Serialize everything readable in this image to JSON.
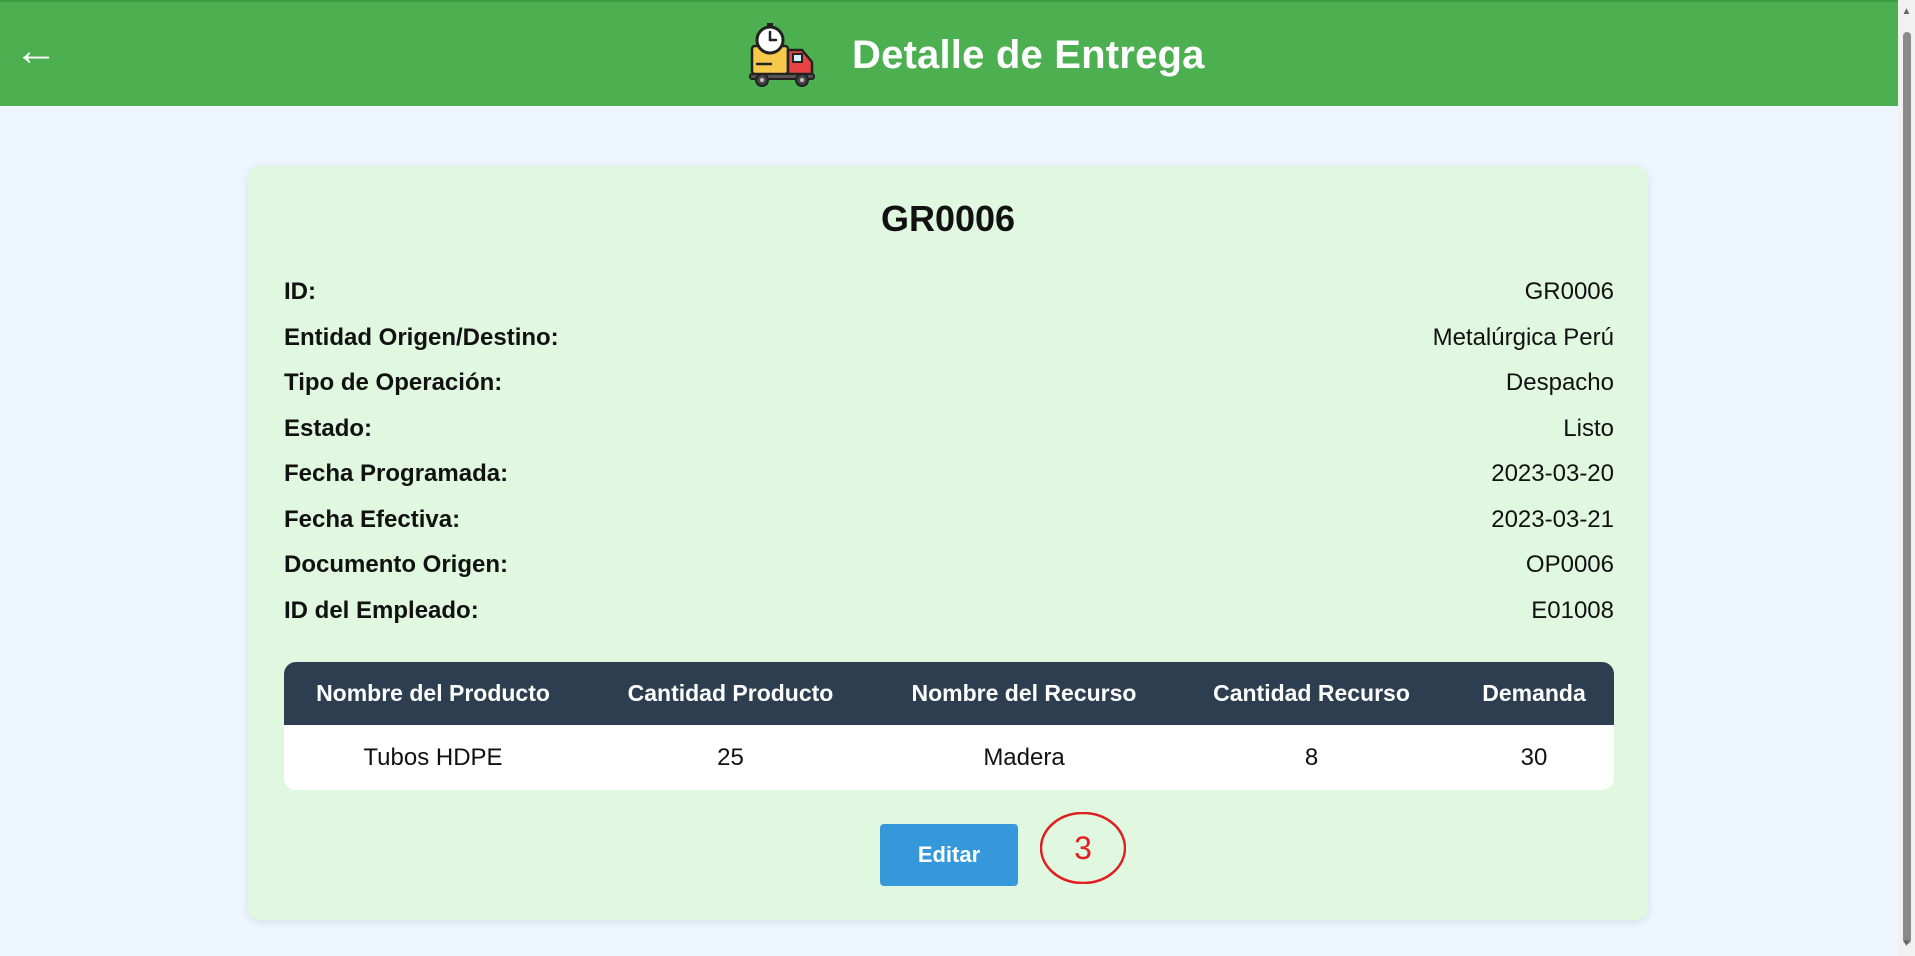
{
  "header": {
    "back_label": "←",
    "title": "Detalle de Entrega",
    "icon": "delivery-truck-clock-icon",
    "color": "#4caf50"
  },
  "card": {
    "title": "GR0006",
    "background": "#e0f7e0",
    "details": [
      {
        "label": "ID:",
        "value": "GR0006"
      },
      {
        "label": "Entidad Origen/Destino:",
        "value": "Metalúrgica Perú"
      },
      {
        "label": "Tipo de Operación:",
        "value": "Despacho"
      },
      {
        "label": "Estado:",
        "value": "Listo"
      },
      {
        "label": "Fecha Programada:",
        "value": "2023-03-20"
      },
      {
        "label": "Fecha Efectiva:",
        "value": "2023-03-21"
      },
      {
        "label": "Documento Origen:",
        "value": "OP0006"
      },
      {
        "label": "ID del Empleado:",
        "value": "E01008"
      }
    ],
    "table": {
      "headers": [
        "Nombre del Producto",
        "Cantidad Producto",
        "Nombre del Recurso",
        "Cantidad Recurso",
        "Demanda"
      ],
      "rows": [
        [
          "Tubos HDPE",
          "25",
          "Madera",
          "8",
          "30"
        ]
      ],
      "header_color": "#2e3e51"
    },
    "edit_label": "Editar",
    "edit_color": "#3498db"
  },
  "annotation": {
    "text": "3",
    "color": "#e02020"
  }
}
